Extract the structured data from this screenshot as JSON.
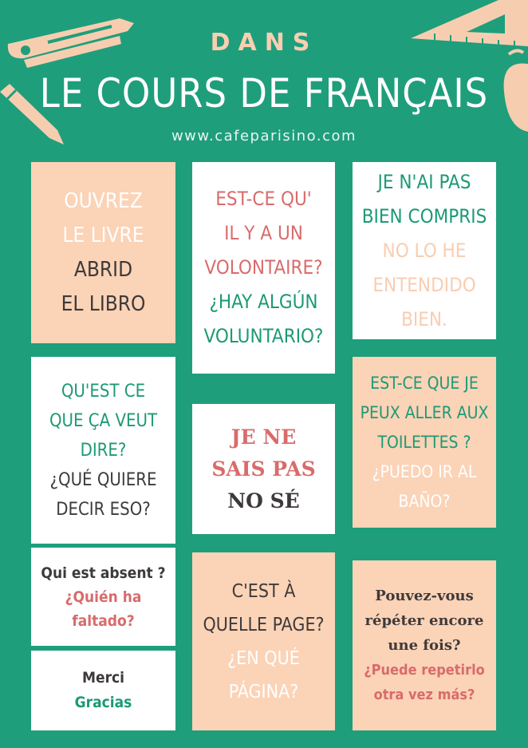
{
  "header": {
    "kicker": "DANS",
    "title": "LE COURS DE FRANÇAIS",
    "url": "www.cafeparisino.com"
  },
  "cards": {
    "c1": [
      "OUVREZ",
      "LE LIVRE",
      "ABRID",
      "EL LIBRO"
    ],
    "c2": [
      "EST-CE QU'",
      "IL Y A UN",
      "VOLONTAIRE?",
      "¿HAY ALGÚN",
      "VOLUNTARIO?"
    ],
    "c3": [
      "JE N'AI PAS",
      "BIEN COMPRIS",
      "NO LO HE",
      "ENTENDIDO",
      "BIEN."
    ],
    "c4": [
      "QU'EST CE",
      "QUE ÇA VEUT",
      "DIRE?",
      "¿QUÉ QUIERE",
      "DECIR ESO?"
    ],
    "c5": [
      "JE NE",
      "SAIS PAS",
      "NO SÉ"
    ],
    "c6": [
      "EST-CE QUE JE",
      "PEUX ALLER AUX",
      "TOILETTES ?",
      "¿PUEDO IR AL",
      "BAÑO?"
    ],
    "c7": [
      "Qui est absent ?",
      "¿Quién ha",
      "faltado?"
    ],
    "c8": [
      "Merci",
      "Gracias"
    ],
    "c9": [
      "C'EST À",
      "QUELLE PAGE?",
      "¿EN QUÉ",
      "PÁGINA?"
    ],
    "c10": [
      "Pouvez-vous",
      "répéter encore",
      "une fois?",
      "¿Puede repetirlo",
      "otra vez más?"
    ]
  },
  "icons": [
    "stapler-icon",
    "pencil-icon",
    "set-square-icon",
    "apple-icon"
  ],
  "colors": {
    "background": "#1f9e7c",
    "peach": "#fbd3b7",
    "white": "#ffffff",
    "pink": "#d96b6b",
    "green": "#1c9a75",
    "dark": "#3e3a3a"
  }
}
